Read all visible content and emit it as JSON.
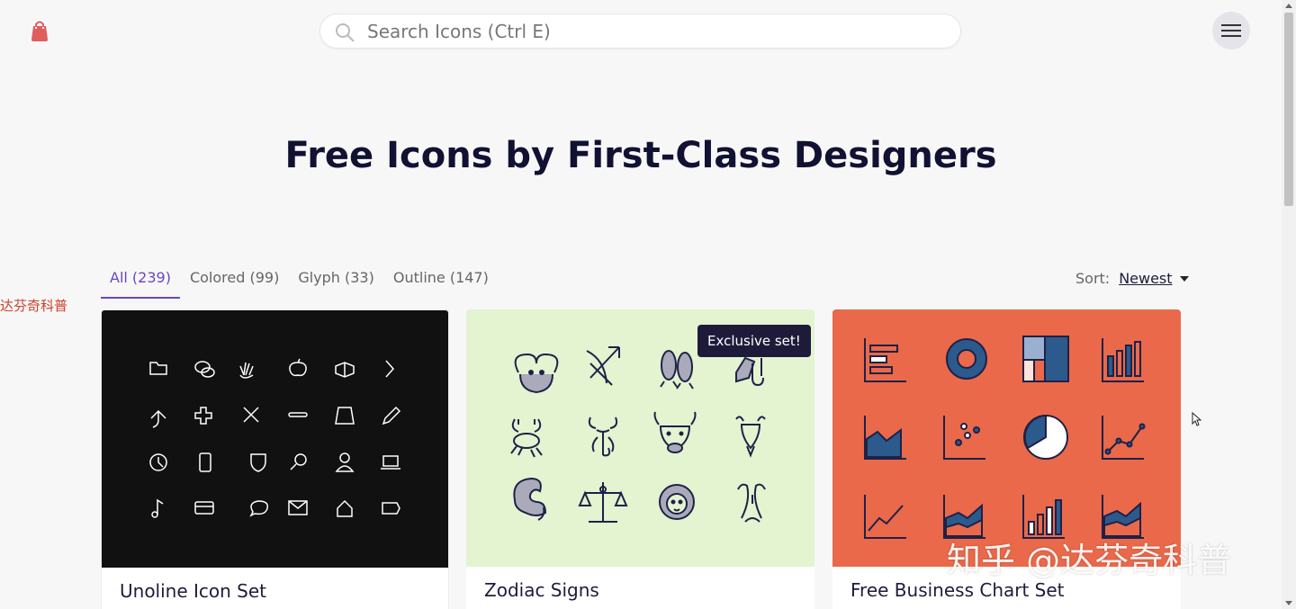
{
  "header": {
    "logo_icon": "shopping-bag-icon",
    "brand_color": "#e05d5d",
    "search": {
      "placeholder": "Search Icons (Ctrl E)",
      "value": ""
    },
    "menu_icon": "hamburger-menu-icon"
  },
  "hero": {
    "title": "Free Icons by First-Class Designers"
  },
  "filters": {
    "tabs": [
      {
        "label": "All (239)",
        "active": true
      },
      {
        "label": "Colored (99)",
        "active": false
      },
      {
        "label": "Glyph (33)",
        "active": false
      },
      {
        "label": "Outline (147)",
        "active": false
      }
    ],
    "accent_color": "#6b46c1",
    "sort": {
      "label": "Sort:",
      "value": "Newest"
    }
  },
  "side_text": "达芬奇科普",
  "cards": [
    {
      "title": "Unoline Icon Set",
      "background": "#111111",
      "icons": [
        "folder-icon",
        "chat-icon",
        "hand-icon",
        "apple-icon",
        "box-icon",
        "chevron-right-icon",
        "arrow-up-right-icon",
        "plus-cross-icon",
        "x-cross-icon",
        "minus-icon",
        "trapezoid-icon",
        "pencil-icon",
        "clock-icon",
        "phone-icon",
        "shield-icon",
        "search-icon",
        "user-icon",
        "laptop-icon",
        "music-note-icon",
        "card-icon",
        "speech-bubble-icon",
        "mail-icon",
        "home-icon",
        "tag-icon"
      ]
    },
    {
      "title": "Zodiac Signs",
      "background": "#e4f3d0",
      "badge": "Exclusive set!",
      "icons": [
        "aries-icon",
        "sagittarius-icon",
        "pisces-icon",
        "capricorn-icon",
        "cancer-icon",
        "scorpio-icon",
        "taurus-icon",
        "capricorn-goat-icon",
        "virgo-icon",
        "libra-icon",
        "leo-icon",
        "gemini-icon"
      ]
    },
    {
      "title": "Free Business Chart Set",
      "background": "#e9694a",
      "icons": [
        "bar-chart-horizontal-icon",
        "donut-chart-icon",
        "treemap-icon",
        "bar-chart-icon",
        "area-chart-icon",
        "scatter-chart-icon",
        "pie-chart-icon",
        "line-dots-chart-icon",
        "line-chart-icon",
        "stacked-area-chart-icon",
        "column-chart-icon",
        "area-chart-2-icon"
      ]
    }
  ],
  "watermark": "知乎 @达芬奇科普"
}
